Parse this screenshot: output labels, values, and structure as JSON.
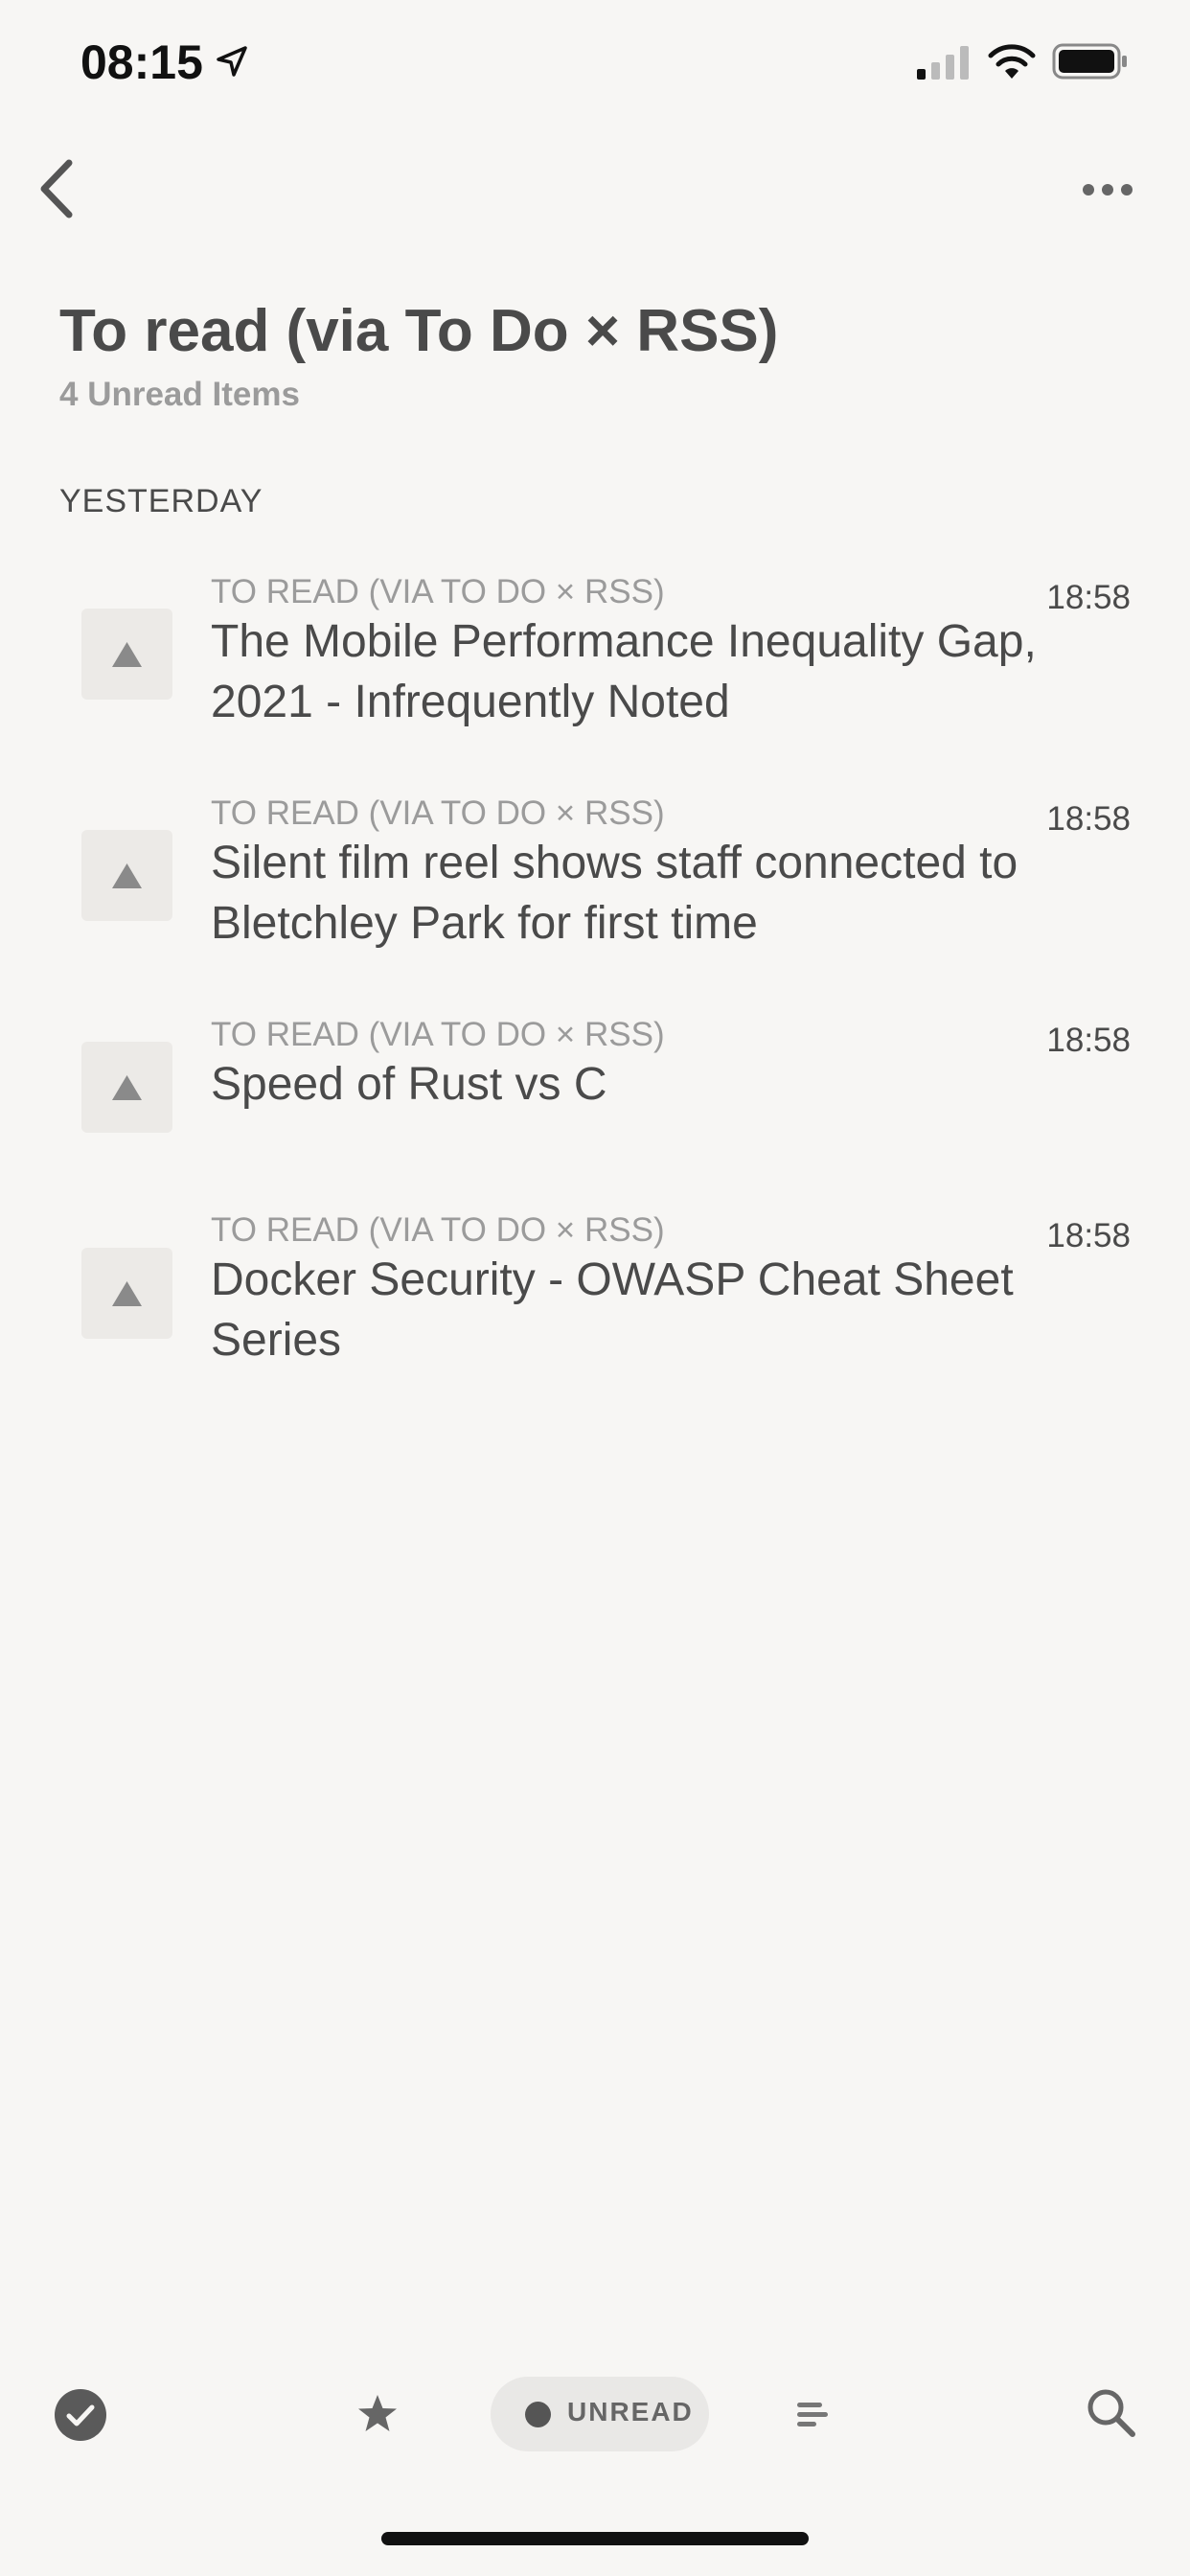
{
  "status_bar": {
    "time": "08:15",
    "location_icon": "location-arrow-icon",
    "signal_icon": "cellular-signal-icon",
    "wifi_icon": "wifi-icon",
    "battery_icon": "battery-icon"
  },
  "nav": {
    "back_icon": "chevron-left-icon",
    "more_icon": "ellipsis-icon"
  },
  "header": {
    "title": "To read (via To Do × RSS)",
    "subtitle": "4 Unread Items"
  },
  "sections": [
    {
      "label": "YESTERDAY",
      "items": [
        {
          "feed": "TO READ (VIA TO DO × RSS)",
          "time": "18:58",
          "title": "The Mobile Performance Inequality Gap, 2021 - Infrequently Noted",
          "thumb_icon": "placeholder-triangle-icon"
        },
        {
          "feed": "TO READ (VIA TO DO × RSS)",
          "time": "18:58",
          "title": "Silent film reel shows staff connected to Bletchley Park for first time",
          "thumb_icon": "placeholder-triangle-icon"
        },
        {
          "feed": "TO READ (VIA TO DO × RSS)",
          "time": "18:58",
          "title": "Speed of Rust vs C",
          "thumb_icon": "placeholder-triangle-icon"
        },
        {
          "feed": "TO READ (VIA TO DO × RSS)",
          "time": "18:58",
          "title": "Docker Security - OWASP Cheat Sheet Series",
          "thumb_icon": "placeholder-triangle-icon"
        }
      ]
    }
  ],
  "tab_bar": {
    "read_icon": "checkmark-circle-icon",
    "starred_icon": "star-icon",
    "unread_label": "UNREAD",
    "unread_icon": "dot-icon",
    "list_icon": "text-lines-icon",
    "search_icon": "search-icon"
  },
  "colors": {
    "background": "#f7f6f4",
    "text_primary": "#4a4a4a",
    "text_secondary": "#9b9b9b",
    "thumb_background": "#eceae7",
    "pill_background": "#e9e8e6"
  }
}
